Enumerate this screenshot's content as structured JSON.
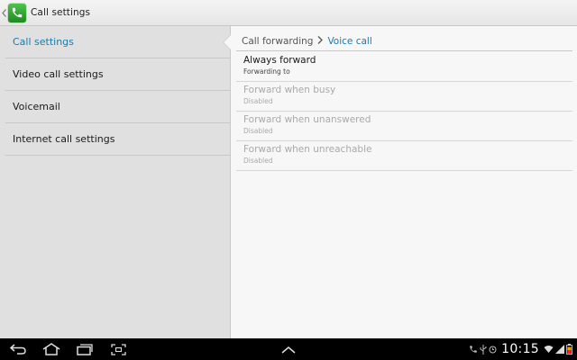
{
  "actionbar": {
    "title": "Call settings",
    "app_icon": "phone-icon"
  },
  "left_menu": {
    "items": [
      {
        "label": "Call settings",
        "selected": true
      },
      {
        "label": "Video call settings",
        "selected": false
      },
      {
        "label": "Voicemail",
        "selected": false
      },
      {
        "label": "Internet call settings",
        "selected": false
      }
    ]
  },
  "breadcrumb": {
    "parent": "Call forwarding",
    "current": "Voice call",
    "separator_icon": "chevron-right-icon"
  },
  "prefs": [
    {
      "title": "Always forward",
      "summary": "Forwarding to",
      "enabled": true
    },
    {
      "title": "Forward when busy",
      "summary": "Disabled",
      "enabled": false
    },
    {
      "title": "Forward when unanswered",
      "summary": "Disabled",
      "enabled": false
    },
    {
      "title": "Forward when unreachable",
      "summary": "Disabled",
      "enabled": false
    }
  ],
  "statusbar": {
    "time": "10:15",
    "icons": [
      "call-active-icon",
      "usb-icon",
      "alarm-icon",
      "wifi-icon",
      "signal-icon",
      "battery-icon"
    ]
  },
  "navbar": {
    "buttons": [
      "back-icon",
      "home-icon",
      "recent-apps-icon",
      "screenshot-icon",
      "menu-up-icon"
    ]
  },
  "colors": {
    "accent": "#1b7aa8",
    "disabled_text": "#a9a9a9",
    "left_panel_bg": "#e0e0e0",
    "right_panel_bg": "#f7f7f7"
  }
}
